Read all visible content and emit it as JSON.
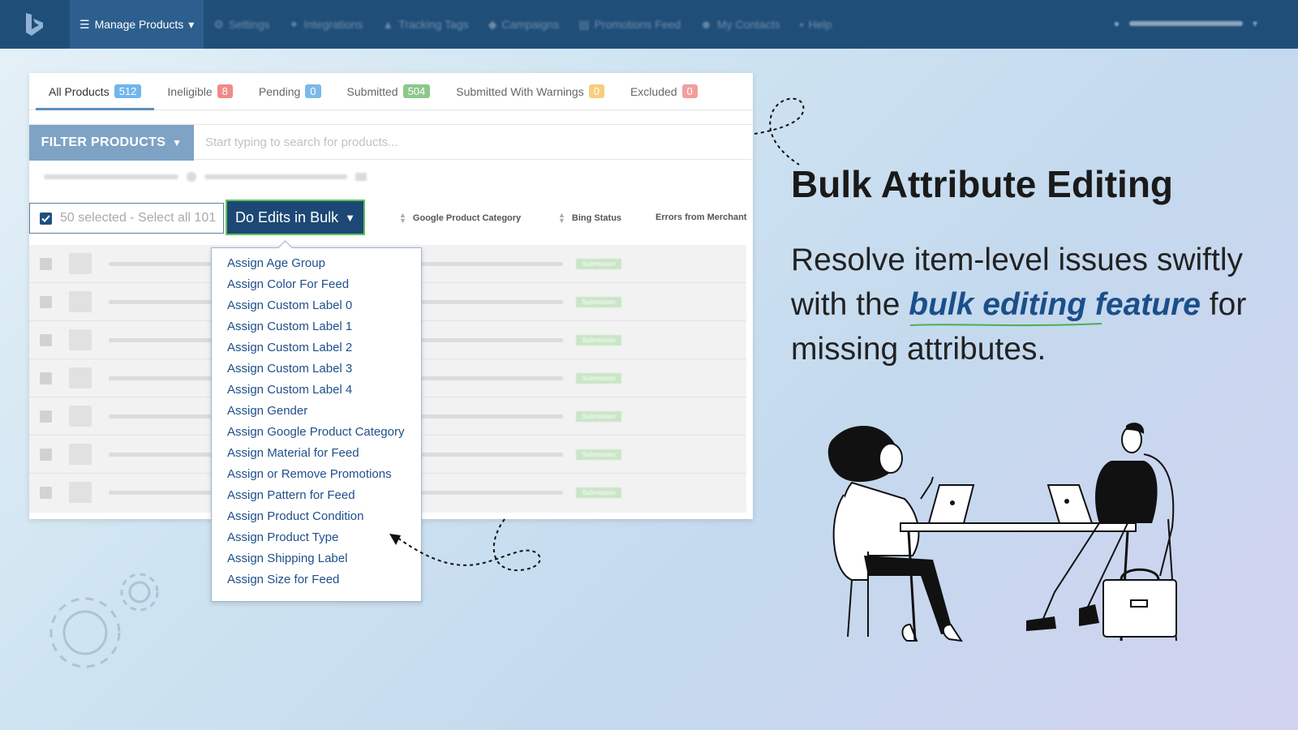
{
  "nav": {
    "manage_products": "Manage Products",
    "items": [
      "Settings",
      "Integrations",
      "Tracking Tags",
      "Campaigns",
      "Promotions Feed",
      "My Contacts",
      "Help"
    ]
  },
  "tabs": [
    {
      "label": "All Products",
      "count": "512",
      "color": "#6fb6ee"
    },
    {
      "label": "Ineligible",
      "count": "8",
      "color": "#f08a8a"
    },
    {
      "label": "Pending",
      "count": "0",
      "color": "#7bb9e8"
    },
    {
      "label": "Submitted",
      "count": "504",
      "color": "#8cc88c"
    },
    {
      "label": "Submitted With Warnings",
      "count": "0",
      "color": "#f5cf7a"
    },
    {
      "label": "Excluded",
      "count": "0",
      "color": "#f29e9e"
    }
  ],
  "filter": {
    "button_label": "FILTER PRODUCTS",
    "search_placeholder": "Start typing to search for products..."
  },
  "selection": {
    "text": "50 selected - Select all 101",
    "bulk_button": "Do Edits in Bulk"
  },
  "columns": {
    "google_category": "Google Product Category",
    "bing_status": "Bing Status",
    "errors": "Errors from Merchant"
  },
  "row_status": "Submission",
  "dropdown_items": [
    "Assign Age Group",
    "Assign Color For Feed",
    "Assign Custom Label 0",
    "Assign Custom Label 1",
    "Assign Custom Label 2",
    "Assign Custom Label 3",
    "Assign Custom Label 4",
    "Assign Gender",
    "Assign Google Product Category",
    "Assign Material for Feed",
    "Assign or Remove Promotions",
    "Assign Pattern for Feed",
    "Assign Product Condition",
    "Assign Product Type",
    "Assign Shipping Label",
    "Assign Size for Feed"
  ],
  "promo": {
    "headline": "Bulk Attribute Editing",
    "sub_before": "Resolve item-level issues swiftly with the ",
    "sub_highlight": "bulk editing feature",
    "sub_after": " for missing attributes."
  },
  "colors": {
    "nav_bg": "#1f4e79",
    "accent_blue": "#1b4f8a",
    "bulk_border": "#5fc15f"
  }
}
